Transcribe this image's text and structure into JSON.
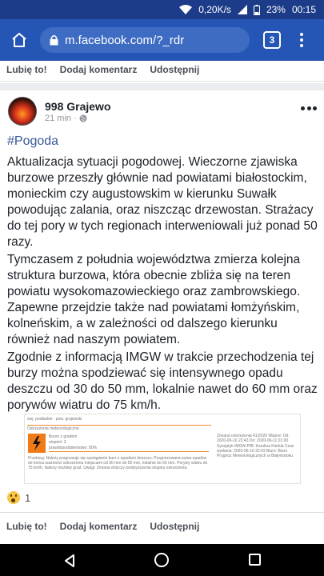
{
  "status_bar": {
    "speed": "0,20K/s",
    "battery": "23%",
    "time": "00:15"
  },
  "browser": {
    "url": "m.facebook.com/?_rdr",
    "tab_count": "3"
  },
  "top_actions": {
    "like": "Lubię to!",
    "comment": "Dodaj komentarz",
    "share": "Udostępnij"
  },
  "post": {
    "page_name": "998 Grajewo",
    "time": "21 min",
    "hashtag": "#Pogoda",
    "paragraph_1": "Aktualizacja sytuacji pogodowej. Wieczorne zjawiska burzowe przeszły głównie nad powiatami białostockim, monieckim czy augustowskim w kierunku Suwałk powodując zalania, oraz niszcząc drzewostan. Strażacy do tej pory w tych regionach interweniowali już ponad 50 razy.",
    "paragraph_2": "Tymczasem z południa województwa zmierza kolejna struktura burzowa, która obecnie zbliża się na teren powiatu wysokomazowieckiego oraz zambrowskiego. Zapewne przejdzie także nad powiatami łomżyńskim, kolneńskim, a w zależności od dalszego kierunku również nad naszym powiatem.",
    "paragraph_3": "Zgodnie z informacją IMGW w trakcie przechodzenia tej burzy można spodziewać się intensywnego opadu deszczu od 30 do 50 mm, lokalnie nawet do 60 mm oraz porywów wiatru do 75 km/h.",
    "reaction_count": "1"
  },
  "warning_image": {
    "region": "woj. podlaskie - pow. grajewski",
    "header": "Ostrzeżenia meteorologiczne",
    "title_line1": "Burze z gradem",
    "title_line2": "stopień: 2",
    "probability": "prawdopodobieństwo: 80%",
    "body": "Przebieg: Należy prognozuje się wystąpienie burz z opadami deszczu. Prognozowana suma opadów do końca ważności ostrzeżenia miejscami od 30 mm do 50 mm, lokalnie do 60 mm. Porywy wiatru do 75 km/h. Należy możliwy grad. Uwagi: Zmiana dotyczy podwyższenia stopnia ostrzeżenia.",
    "right": "Zmiana ostrzeżenia 41/2020 Ważne: Od: 2020-06-10 22:43 Do: 2020-06-11 01:00 Synoptyk IMGW-PIB: Karolina Kierkla Czas wydania: 2020-06-10 22:43 Biuro: Biuro Prognoz Meteorologicznych w Białymstoku"
  },
  "bottom_actions": {
    "like": "Lubię to!",
    "comment": "Dodaj komentarz",
    "share": "Udostępnij"
  },
  "icons": [
    "wifi-icon",
    "signal-icon",
    "battery-icon",
    "home-icon",
    "lock-icon",
    "tabs-icon",
    "menu-icon",
    "more-icon",
    "globe-icon",
    "wow-icon",
    "back-icon",
    "recent-apps-icon"
  ],
  "colors": {
    "status_bar": "#1c3c89",
    "browser_bar": "#2656b5",
    "hashtag": "#385898",
    "warning": "#ef7a17"
  }
}
